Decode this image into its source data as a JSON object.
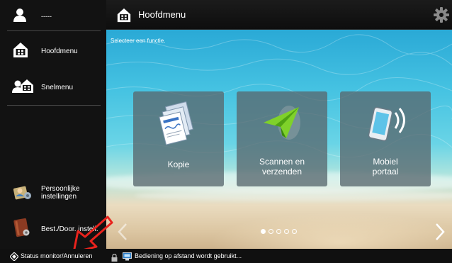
{
  "sidebar": {
    "user_label": "-----",
    "main_menu_label": "Hoofdmenu",
    "quick_menu_label": "Snelmenu",
    "personal_settings_label": "Persoonlijke instellingen",
    "admin_settings_label": "Best./Door. instell."
  },
  "header": {
    "title": "Hoofdmenu"
  },
  "main": {
    "instruction": "Selecteer een functie.",
    "tiles": [
      {
        "label": "Kopie",
        "icon": "copy-icon"
      },
      {
        "label": "Scannen en verzenden",
        "icon": "scan-send-icon"
      },
      {
        "label": "Mobiel portaal",
        "icon": "mobile-portal-icon"
      }
    ],
    "pager": {
      "pages": 5,
      "active": 1
    }
  },
  "status_bar": {
    "button_label": "Status monitor/Annuleren",
    "message": "Bediening op afstand wordt gebruikt..."
  },
  "colors": {
    "sidebar_bg": "#121212",
    "tile_bg": "#58686e",
    "annotation_red": "#e8231d"
  }
}
